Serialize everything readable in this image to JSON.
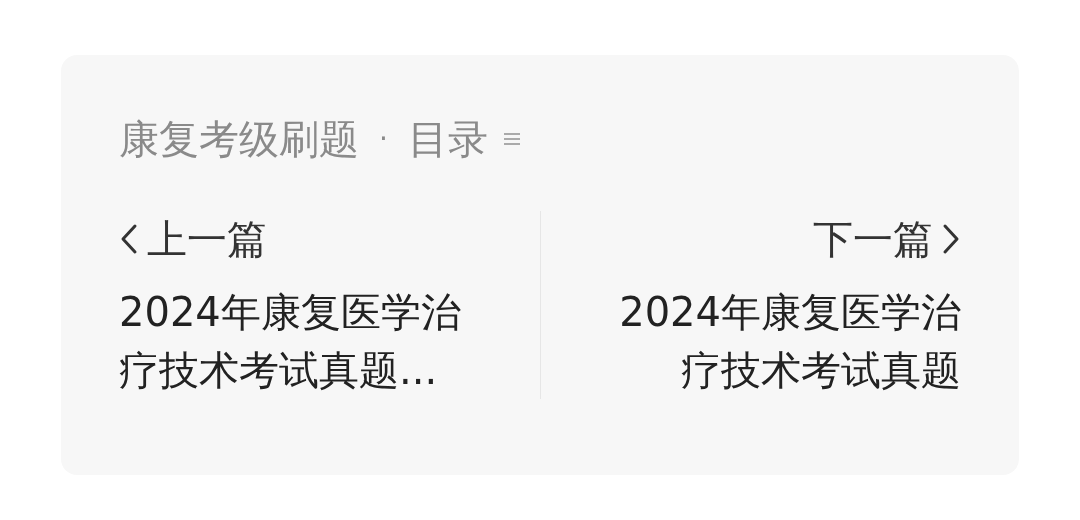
{
  "header": {
    "collection": "康复考级刷题",
    "separator": "·",
    "catalog": "目录"
  },
  "prev": {
    "label": "上一篇",
    "title": "2024年康复医学治疗技术考试真题..."
  },
  "next": {
    "label": "下一篇",
    "title": "2024年康复医学治疗技术考试真题"
  }
}
